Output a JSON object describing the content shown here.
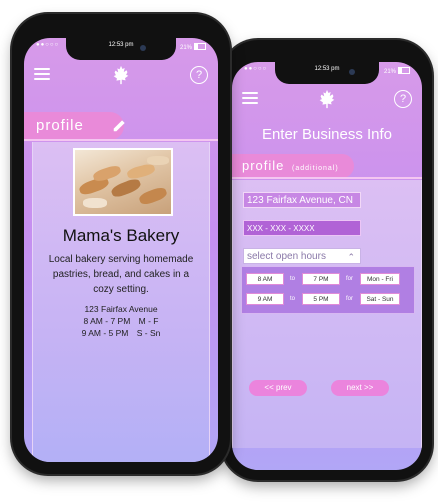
{
  "colors": {
    "accent": "#e98ad9",
    "gradient_top": "#d79ae9",
    "gradient_bottom": "#b1a6f6"
  },
  "front": {
    "status": {
      "signal": "●●○○○",
      "time": "12:53 pm",
      "battery": "21%"
    },
    "nav": {
      "menu_icon": "hamburger-icon",
      "logo_icon": "maple-leaf-icon",
      "help_icon": "help-icon",
      "help_glyph": "?"
    },
    "profile_tab": {
      "label": "profile",
      "edit_icon": "pencil-icon"
    },
    "business": {
      "name": "Mama's Bakery",
      "description": "Local bakery serving homemade pastries, bread, and cakes in a cozy setting.",
      "address": "123 Fairfax Avenue",
      "hours": [
        {
          "time": "8 AM - 7 PM",
          "days": "M - F"
        },
        {
          "time": "9 AM - 5 PM",
          "days": "S - Sn"
        }
      ]
    }
  },
  "back": {
    "status": {
      "signal": "●●○○○",
      "time": "12:53 pm",
      "battery": "21%"
    },
    "nav": {
      "menu_icon": "hamburger-icon",
      "logo_icon": "maple-leaf-icon",
      "help_icon": "help-icon",
      "help_glyph": "?"
    },
    "title": "Enter Business Info",
    "tab": {
      "label": "profile",
      "sublabel": "(additional)"
    },
    "form": {
      "address_value": "123 Fairfax Avenue, CN",
      "phone_value": "XXX - XXX - XXXX",
      "hours_placeholder": "select open hours",
      "hours_rows": [
        {
          "open": "8 AM",
          "to_label": "to",
          "close": "7 PM",
          "for_label": "for",
          "days": "Mon - Fri"
        },
        {
          "open": "9 AM",
          "to_label": "to",
          "close": "5 PM",
          "for_label": "for",
          "days": "Sat - Sun"
        }
      ],
      "prev_label": "<< prev",
      "next_label": "next >>"
    }
  }
}
